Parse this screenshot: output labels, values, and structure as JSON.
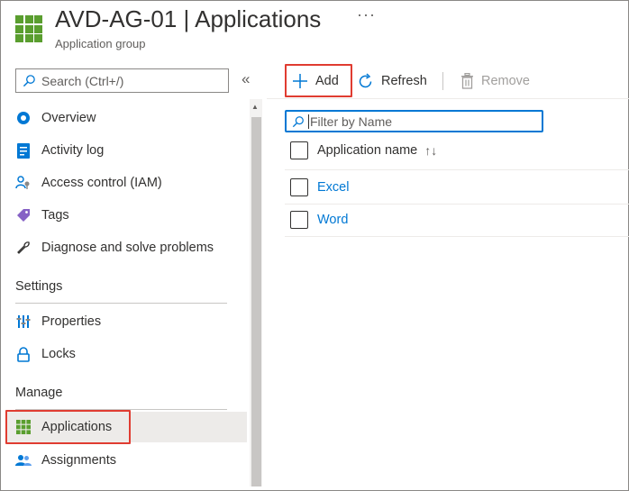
{
  "header": {
    "title": "AVD-AG-01 | Applications",
    "subtitle": "Application group",
    "more": "···",
    "icon": "application-group-icon"
  },
  "sidebar": {
    "search_placeholder": "Search (Ctrl+/)",
    "collapse": "«",
    "items": [
      {
        "label": "Overview",
        "icon": "overview-icon"
      },
      {
        "label": "Activity log",
        "icon": "activity-log-icon"
      },
      {
        "label": "Access control (IAM)",
        "icon": "iam-icon"
      },
      {
        "label": "Tags",
        "icon": "tag-icon"
      },
      {
        "label": "Diagnose and solve problems",
        "icon": "wrench-icon"
      }
    ],
    "settings": {
      "heading": "Settings",
      "items": [
        {
          "label": "Properties",
          "icon": "properties-icon"
        },
        {
          "label": "Locks",
          "icon": "lock-icon"
        }
      ]
    },
    "manage": {
      "heading": "Manage",
      "items": [
        {
          "label": "Applications",
          "icon": "applications-icon",
          "selected": true
        },
        {
          "label": "Assignments",
          "icon": "users-icon"
        }
      ]
    }
  },
  "toolbar": {
    "add_label": "Add",
    "refresh_label": "Refresh",
    "remove_label": "Remove"
  },
  "main": {
    "filter_placeholder": "Filter by Name",
    "column_header": "Application name",
    "sort_glyph": "↑↓",
    "rows": [
      {
        "name": "Excel"
      },
      {
        "name": "Word"
      }
    ]
  },
  "colors": {
    "accent": "#0078d4",
    "highlight": "#e03c31",
    "app_green": "#5a9e2f"
  }
}
